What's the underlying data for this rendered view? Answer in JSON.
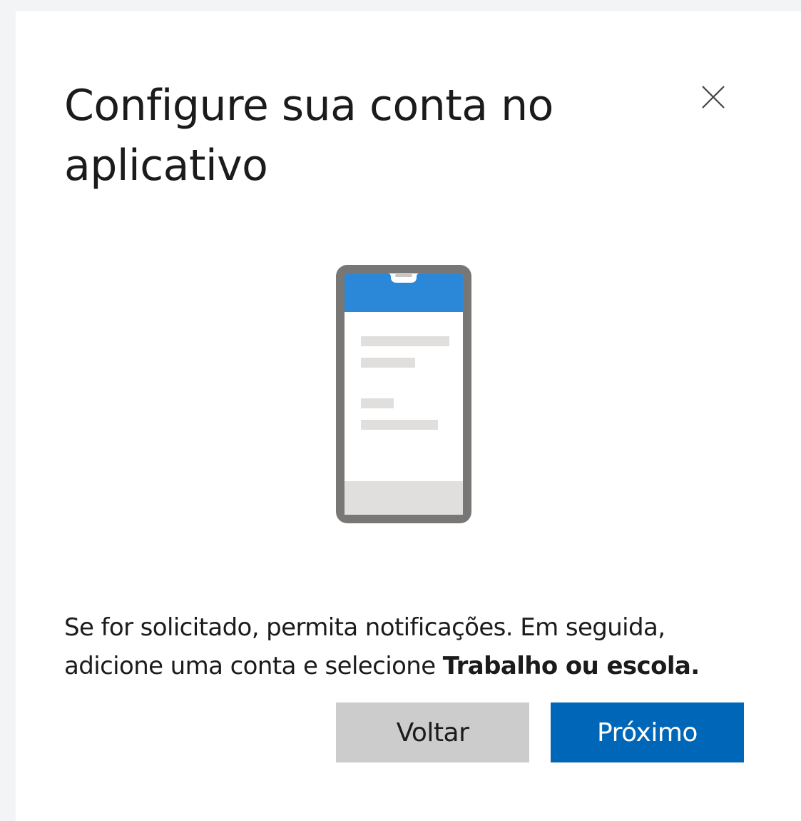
{
  "dialog": {
    "title": "Configure sua conta no aplicativo",
    "close_icon": "close-icon",
    "illustration_icon": "smartphone-icon",
    "instructions": {
      "part1": "Se for solicitado, permita notificações. Em seguida, adicione uma conta e selecione ",
      "emphasis": "Trabalho ou escola."
    },
    "buttons": {
      "back_label": "Voltar",
      "next_label": "Próximo"
    },
    "colors": {
      "primary": "#0067b8",
      "secondary": "#cccccc",
      "phone_header": "#2b88d8",
      "phone_frame": "#797775"
    }
  }
}
